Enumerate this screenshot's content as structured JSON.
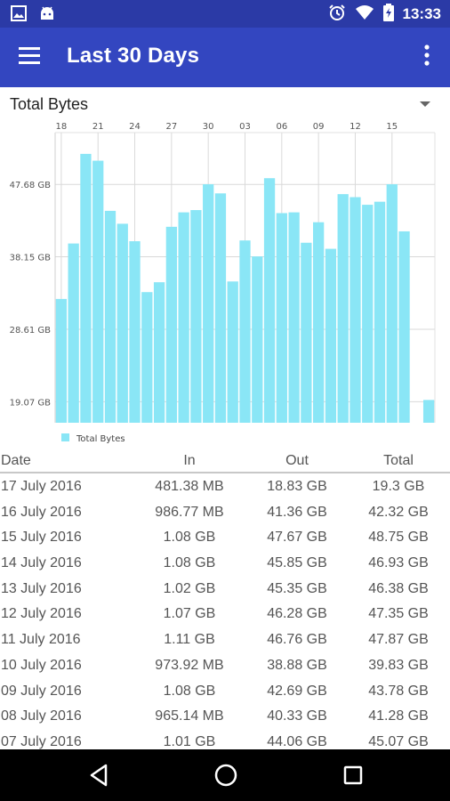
{
  "status_bar": {
    "time": "13:33",
    "left_icons": [
      "image-icon",
      "android-icon"
    ],
    "right_icons": [
      "alarm-icon",
      "wifi-icon",
      "battery-charging-icon"
    ]
  },
  "app_bar": {
    "title": "Last 30 Days",
    "menu_icon": "hamburger-menu-icon",
    "overflow_icon": "overflow-menu-icon"
  },
  "chart_selector": {
    "selected": "Total Bytes"
  },
  "chart_data": {
    "type": "bar",
    "categories": [
      "18",
      "19",
      "20",
      "21",
      "22",
      "23",
      "24",
      "25",
      "26",
      "27",
      "28",
      "29",
      "30",
      "31",
      "01",
      "02",
      "03",
      "04",
      "05",
      "06",
      "07",
      "08",
      "09",
      "10",
      "11",
      "12",
      "13",
      "14",
      "15",
      "16",
      "17"
    ],
    "x_tick_labels": [
      "18",
      "21",
      "24",
      "27",
      "30",
      "03",
      "06",
      "09",
      "12",
      "15"
    ],
    "series": [
      {
        "name": "Total Bytes",
        "color": "#8ae6f6",
        "values": [
          32.6,
          39.9,
          51.7,
          50.8,
          44.2,
          42.5,
          40.2,
          33.5,
          34.8,
          42.1,
          44.0,
          44.3,
          47.7,
          46.5,
          34.9,
          40.3,
          38.2,
          48.5,
          43.9,
          44.0,
          40.0,
          42.7,
          39.2,
          46.4,
          46.0,
          45.0,
          45.4,
          47.7,
          41.5,
          0,
          19.3
        ]
      }
    ],
    "y_ticks": [
      "19.07 GB",
      "28.61 GB",
      "38.15 GB",
      "47.68 GB"
    ],
    "y_tick_values": [
      19.07,
      28.61,
      38.15,
      47.68
    ],
    "ylim": [
      16.3,
      54.5
    ],
    "legend": "bottom-left",
    "grid": true
  },
  "table": {
    "headers": {
      "date": "Date",
      "in": "In",
      "out": "Out",
      "total": "Total"
    },
    "rows": [
      {
        "date": "17 July 2016",
        "in": "481.38 MB",
        "out": "18.83 GB",
        "total": "19.3 GB"
      },
      {
        "date": "16 July 2016",
        "in": "986.77 MB",
        "out": "41.36 GB",
        "total": "42.32 GB"
      },
      {
        "date": "15 July 2016",
        "in": "1.08 GB",
        "out": "47.67 GB",
        "total": "48.75 GB"
      },
      {
        "date": "14 July 2016",
        "in": "1.08 GB",
        "out": "45.85 GB",
        "total": "46.93 GB"
      },
      {
        "date": "13 July 2016",
        "in": "1.02 GB",
        "out": "45.35 GB",
        "total": "46.38 GB"
      },
      {
        "date": "12 July 2016",
        "in": "1.07 GB",
        "out": "46.28 GB",
        "total": "47.35 GB"
      },
      {
        "date": "11 July 2016",
        "in": "1.11 GB",
        "out": "46.76 GB",
        "total": "47.87 GB"
      },
      {
        "date": "10 July 2016",
        "in": "973.92 MB",
        "out": "38.88 GB",
        "total": "39.83 GB"
      },
      {
        "date": "09 July 2016",
        "in": "1.08 GB",
        "out": "42.69 GB",
        "total": "43.78 GB"
      },
      {
        "date": "08 July 2016",
        "in": "965.14 MB",
        "out": "40.33 GB",
        "total": "41.28 GB"
      },
      {
        "date": "07 July 2016",
        "in": "1.01 GB",
        "out": "44.06 GB",
        "total": "45.07 GB"
      }
    ]
  },
  "nav_bar": {
    "icons": [
      "back-icon",
      "home-icon",
      "recents-icon"
    ]
  },
  "colors": {
    "app_bar": "#3346c0",
    "status_bar": "#2b3aa6",
    "bar": "#8ae6f6"
  }
}
